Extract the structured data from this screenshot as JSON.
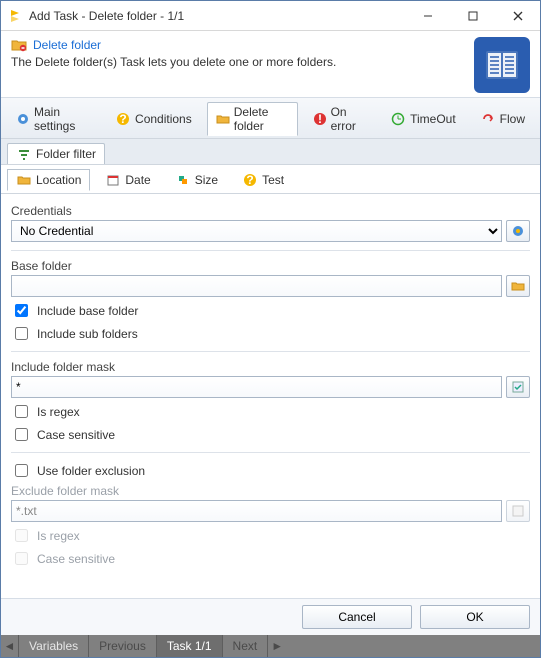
{
  "window": {
    "title": "Add Task - Delete folder - 1/1"
  },
  "header": {
    "title": "Delete folder",
    "desc": "The Delete folder(s) Task lets you delete one or more folders."
  },
  "mainTabs": {
    "items": [
      {
        "label": "Main settings"
      },
      {
        "label": "Conditions"
      },
      {
        "label": "Delete folder"
      },
      {
        "label": "On error"
      },
      {
        "label": "TimeOut"
      },
      {
        "label": "Flow"
      }
    ],
    "active": 2
  },
  "subTabs": {
    "items": [
      {
        "label": "Folder filter"
      }
    ],
    "active": 0
  },
  "innerTabs": {
    "items": [
      {
        "label": "Location"
      },
      {
        "label": "Date"
      },
      {
        "label": "Size"
      },
      {
        "label": "Test"
      }
    ],
    "active": 0
  },
  "form": {
    "credentials": {
      "label": "Credentials",
      "value": "No Credential"
    },
    "baseFolder": {
      "label": "Base folder",
      "value": ""
    },
    "includeBase": {
      "label": "Include base folder",
      "checked": true
    },
    "includeSub": {
      "label": "Include sub folders",
      "checked": false
    },
    "includeMask": {
      "label": "Include folder mask",
      "value": "*"
    },
    "includeRegex": {
      "label": "Is regex",
      "checked": false
    },
    "includeCase": {
      "label": "Case sensitive",
      "checked": false
    },
    "useExclusion": {
      "label": "Use folder exclusion",
      "checked": false
    },
    "excludeMask": {
      "label": "Exclude folder mask",
      "value": "*.txt"
    },
    "excludeRegex": {
      "label": "Is regex",
      "checked": false
    },
    "excludeCase": {
      "label": "Case sensitive",
      "checked": false
    }
  },
  "buttons": {
    "cancel": "Cancel",
    "ok": "OK"
  },
  "status": {
    "variables": "Variables",
    "previous": "Previous",
    "current": "Task 1/1",
    "next": "Next"
  }
}
